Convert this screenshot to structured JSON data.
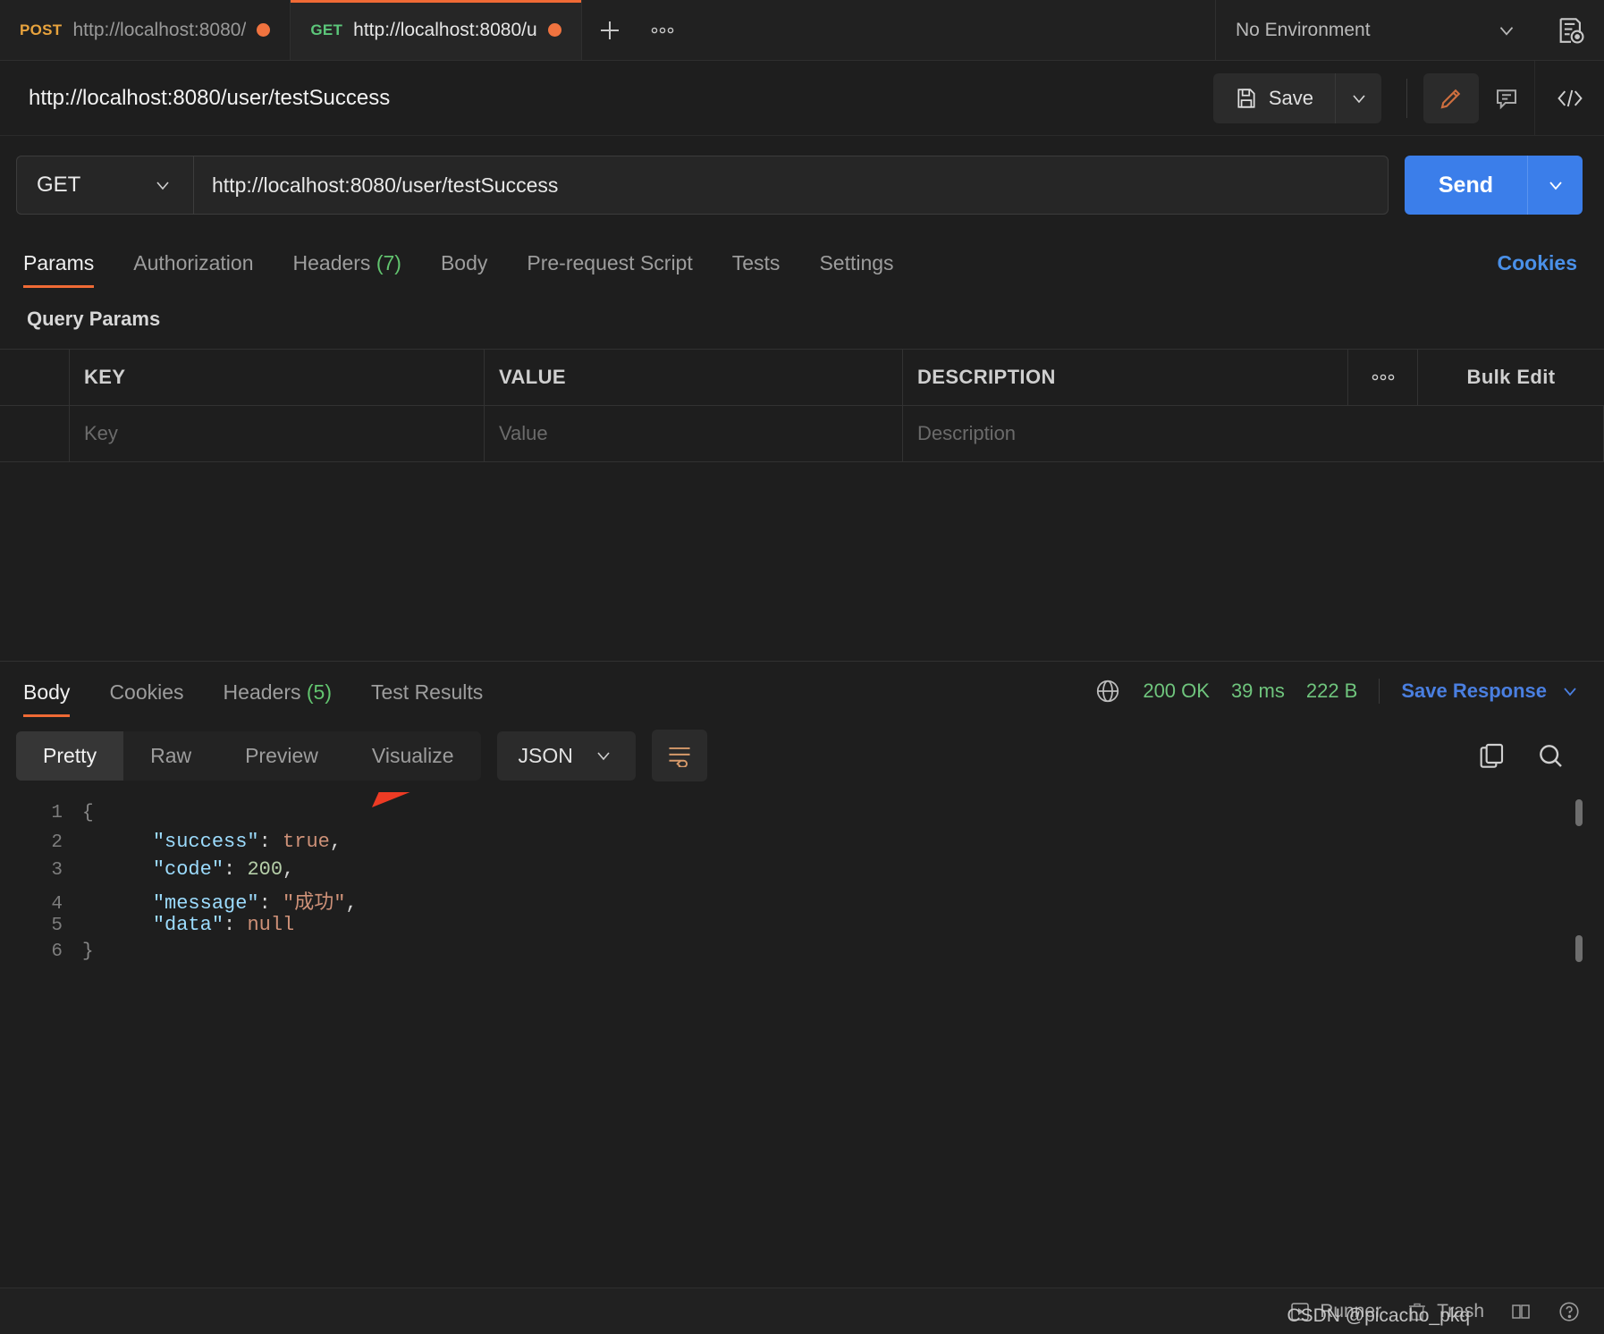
{
  "tabs": [
    {
      "method": "POST",
      "method_class": "post",
      "url": "http://localhost:8080/",
      "active": false,
      "unsaved": true
    },
    {
      "method": "GET",
      "method_class": "get",
      "url": "http://localhost:8080/u",
      "active": true,
      "unsaved": true
    }
  ],
  "tabbar": {
    "new_tab_label": "+",
    "more_label": "●●●",
    "environment": "No Environment"
  },
  "title": {
    "request_name": "http://localhost:8080/user/testSuccess",
    "save_label": "Save"
  },
  "url_row": {
    "method": "GET",
    "url": "http://localhost:8080/user/testSuccess",
    "send_label": "Send"
  },
  "request_tabs": [
    {
      "label": "Params",
      "count": "",
      "active": true
    },
    {
      "label": "Authorization",
      "count": "",
      "active": false
    },
    {
      "label": "Headers",
      "count": "(7)",
      "active": false
    },
    {
      "label": "Body",
      "count": "",
      "active": false
    },
    {
      "label": "Pre-request Script",
      "count": "",
      "active": false
    },
    {
      "label": "Tests",
      "count": "",
      "active": false
    },
    {
      "label": "Settings",
      "count": "",
      "active": false
    }
  ],
  "cookies_link": "Cookies",
  "query_params": {
    "section_label": "Query Params",
    "headers": {
      "key": "KEY",
      "value": "VALUE",
      "description": "DESCRIPTION"
    },
    "bulk_edit_label": "Bulk Edit",
    "placeholder_row": {
      "key": "Key",
      "value": "Value",
      "description": "Description"
    }
  },
  "response": {
    "tabs": [
      {
        "label": "Body",
        "count": "",
        "active": true
      },
      {
        "label": "Cookies",
        "count": "",
        "active": false
      },
      {
        "label": "Headers",
        "count": "(5)",
        "active": false
      },
      {
        "label": "Test Results",
        "count": "",
        "active": false
      }
    ],
    "status": "200 OK",
    "time": "39 ms",
    "size": "222 B",
    "save_response_label": "Save Response",
    "view_modes": [
      {
        "label": "Pretty",
        "active": true
      },
      {
        "label": "Raw",
        "active": false
      },
      {
        "label": "Preview",
        "active": false
      },
      {
        "label": "Visualize",
        "active": false
      }
    ],
    "format": "JSON",
    "body_lines": [
      {
        "n": "1",
        "fold": "{",
        "segments": []
      },
      {
        "n": "2",
        "fold": "",
        "segments": [
          {
            "t": "    ",
            "c": "p"
          },
          {
            "t": "\"success\"",
            "c": "k"
          },
          {
            "t": ": ",
            "c": "p"
          },
          {
            "t": "true",
            "c": "lit"
          },
          {
            "t": ",",
            "c": "p"
          }
        ]
      },
      {
        "n": "3",
        "fold": "",
        "segments": [
          {
            "t": "    ",
            "c": "p"
          },
          {
            "t": "\"code\"",
            "c": "k"
          },
          {
            "t": ": ",
            "c": "p"
          },
          {
            "t": "200",
            "c": "num"
          },
          {
            "t": ",",
            "c": "p"
          }
        ]
      },
      {
        "n": "4",
        "fold": "",
        "segments": [
          {
            "t": "    ",
            "c": "p"
          },
          {
            "t": "\"message\"",
            "c": "k"
          },
          {
            "t": ": ",
            "c": "p"
          },
          {
            "t": "\"成功\"",
            "c": "str"
          },
          {
            "t": ",",
            "c": "p"
          }
        ]
      },
      {
        "n": "5",
        "fold": "",
        "segments": [
          {
            "t": "    ",
            "c": "p"
          },
          {
            "t": "\"data\"",
            "c": "k"
          },
          {
            "t": ": ",
            "c": "p"
          },
          {
            "t": "null",
            "c": "lit"
          }
        ]
      },
      {
        "n": "6",
        "fold": "}",
        "segments": []
      }
    ]
  },
  "status_bar": {
    "runner_label": "Runner",
    "trash_label": "Trash",
    "watermark": "CSDN @picacho_pkq"
  },
  "colors": {
    "accent_orange": "#f06a35",
    "send_blue": "#3b7eea",
    "link_blue": "#4a7fe0",
    "success_green": "#6fc57d",
    "method_get": "#5cc77a",
    "method_post": "#e8a33d",
    "arrow_red": "#ee3b24"
  }
}
